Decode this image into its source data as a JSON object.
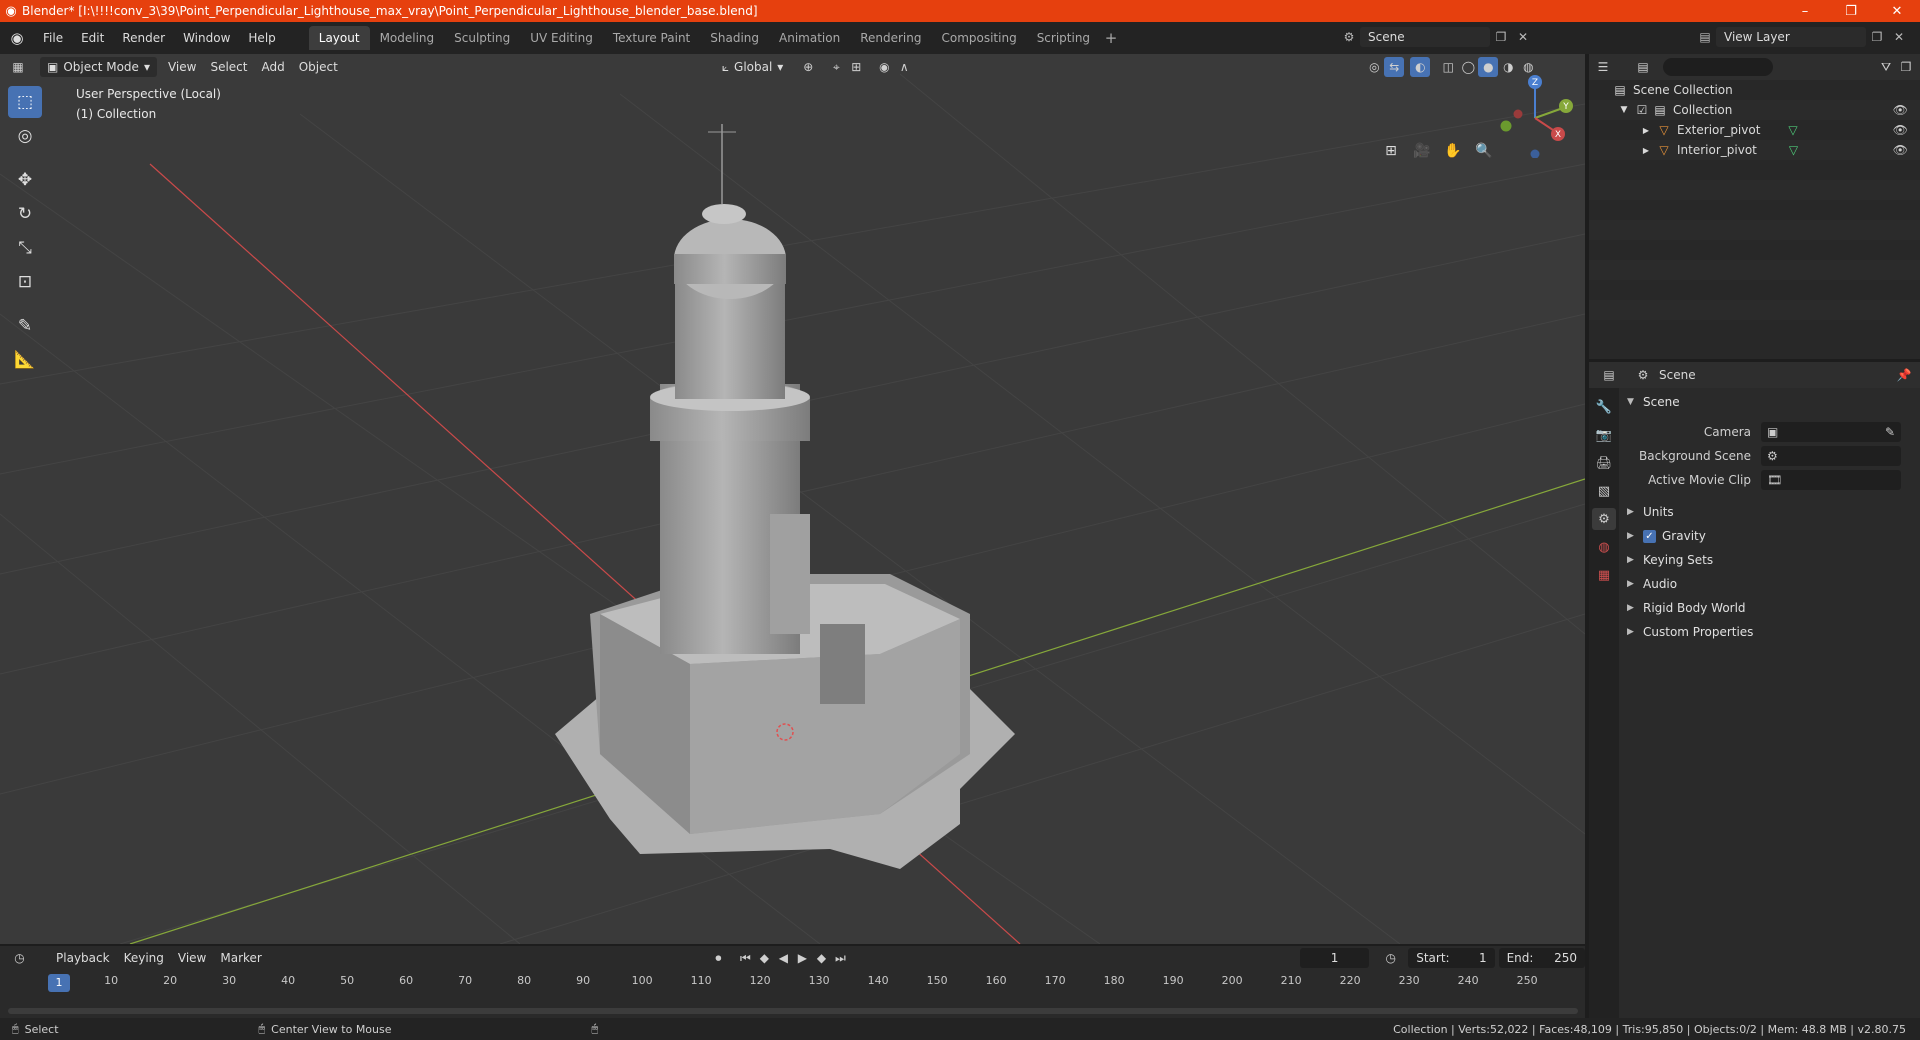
{
  "window": {
    "title": "Blender* [I:\\!!!!conv_3\\39\\Point_Perpendicular_Lighthouse_max_vray\\Point_Perpendicular_Lighthouse_blender_base.blend]",
    "minimize": "–",
    "maximize": "❐",
    "close": "✕"
  },
  "menu": [
    "File",
    "Edit",
    "Render",
    "Window",
    "Help"
  ],
  "workspaces": [
    "Layout",
    "Modeling",
    "Sculpting",
    "UV Editing",
    "Texture Paint",
    "Shading",
    "Animation",
    "Rendering",
    "Compositing",
    "Scripting"
  ],
  "active_workspace": "Layout",
  "scene_selector": "Scene",
  "view_layer_selector": "View Layer",
  "viewport": {
    "mode": "Object Mode",
    "menus": [
      "View",
      "Select",
      "Add",
      "Object"
    ],
    "orientation": "Global",
    "info_line1": "User Perspective (Local)",
    "info_line2": "(1) Collection",
    "gizmo": {
      "x": "X",
      "y": "Y",
      "z": "Z"
    }
  },
  "outliner": {
    "search_placeholder": "",
    "root": "Scene Collection",
    "collection": "Collection",
    "items": [
      "Exterior_pivot",
      "Interior_pivot"
    ]
  },
  "properties": {
    "header": "Scene",
    "section": "Scene",
    "fields": [
      {
        "label": "Camera",
        "value": ""
      },
      {
        "label": "Background Scene",
        "value": ""
      },
      {
        "label": "Active Movie Clip",
        "value": ""
      }
    ],
    "subsections": [
      "Units",
      "Gravity",
      "Keying Sets",
      "Audio",
      "Rigid Body World",
      "Custom Properties"
    ]
  },
  "timeline": {
    "menus": [
      "Playback",
      "Keying",
      "View",
      "Marker"
    ],
    "current_frame": "1",
    "start_label": "Start:",
    "start": "1",
    "end_label": "End:",
    "end": "250",
    "ticks": [
      "1",
      "10",
      "20",
      "30",
      "40",
      "50",
      "60",
      "70",
      "80",
      "90",
      "100",
      "110",
      "120",
      "130",
      "140",
      "150",
      "160",
      "170",
      "180",
      "190",
      "200",
      "210",
      "220",
      "230",
      "240",
      "250"
    ]
  },
  "statusbar": {
    "left1": "Select",
    "left2": "Center View to Mouse",
    "right": "Collection | Verts:52,022 | Faces:48,109 | Tris:95,850 | Objects:0/2 | Mem: 48.8 MB | v2.80.75"
  },
  "colors": {
    "title_bar": "#e6400e",
    "accent": "#4772b3",
    "axis_x": "#c94a4a",
    "axis_y": "#86a83a",
    "axis_z": "#4a7fd0"
  }
}
